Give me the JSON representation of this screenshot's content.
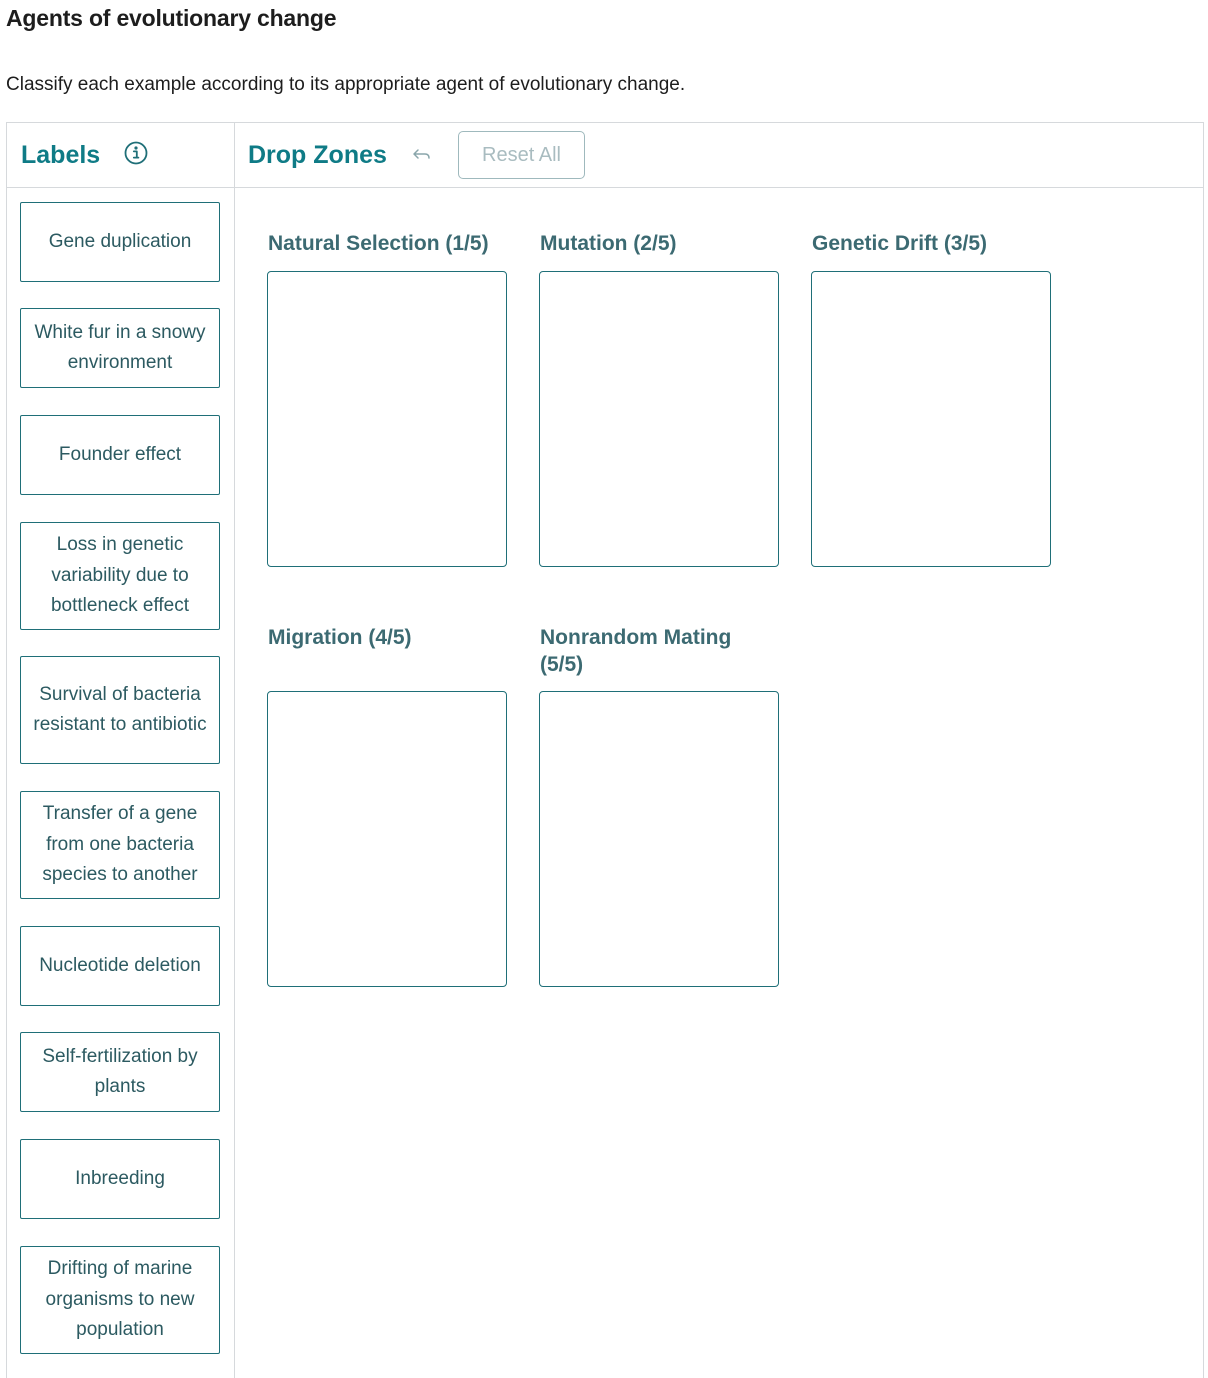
{
  "page": {
    "title": "Agents of evolutionary change",
    "instructions": "Classify each example according to its appropriate agent of evolutionary change."
  },
  "labels_panel": {
    "heading": "Labels",
    "info_icon": "info-circle-icon",
    "items": [
      {
        "label": "Gene duplication"
      },
      {
        "label": "White fur in a snowy environment"
      },
      {
        "label": "Founder effect"
      },
      {
        "label": "Loss in genetic variability due to bottleneck effect"
      },
      {
        "label": "Survival of bacteria resistant to antibiotic"
      },
      {
        "label": "Transfer of a gene from one bacteria species to another"
      },
      {
        "label": "Nucleotide deletion"
      },
      {
        "label": "Self-fertilization by plants"
      },
      {
        "label": "Inbreeding"
      },
      {
        "label": "Drifting of marine organisms to new population"
      }
    ]
  },
  "drop_zones_panel": {
    "heading": "Drop Zones",
    "undo_icon": "undo-arrow-icon",
    "reset_label": "Reset All",
    "zones": [
      {
        "title": "Natural Selection (1/5)"
      },
      {
        "title": "Mutation (2/5)"
      },
      {
        "title": "Genetic Drift (3/5)"
      },
      {
        "title": "Migration (4/5)"
      },
      {
        "title": "Nonrandom Mating (5/5)"
      }
    ]
  },
  "colors": {
    "accent_teal": "#0f7b86",
    "label_text": "#2c5a61",
    "zone_title": "#3c6a72",
    "border_teal": "#1f6f78",
    "panel_border": "#d6d9dc",
    "reset_disabled_text": "#a9bcc0"
  }
}
